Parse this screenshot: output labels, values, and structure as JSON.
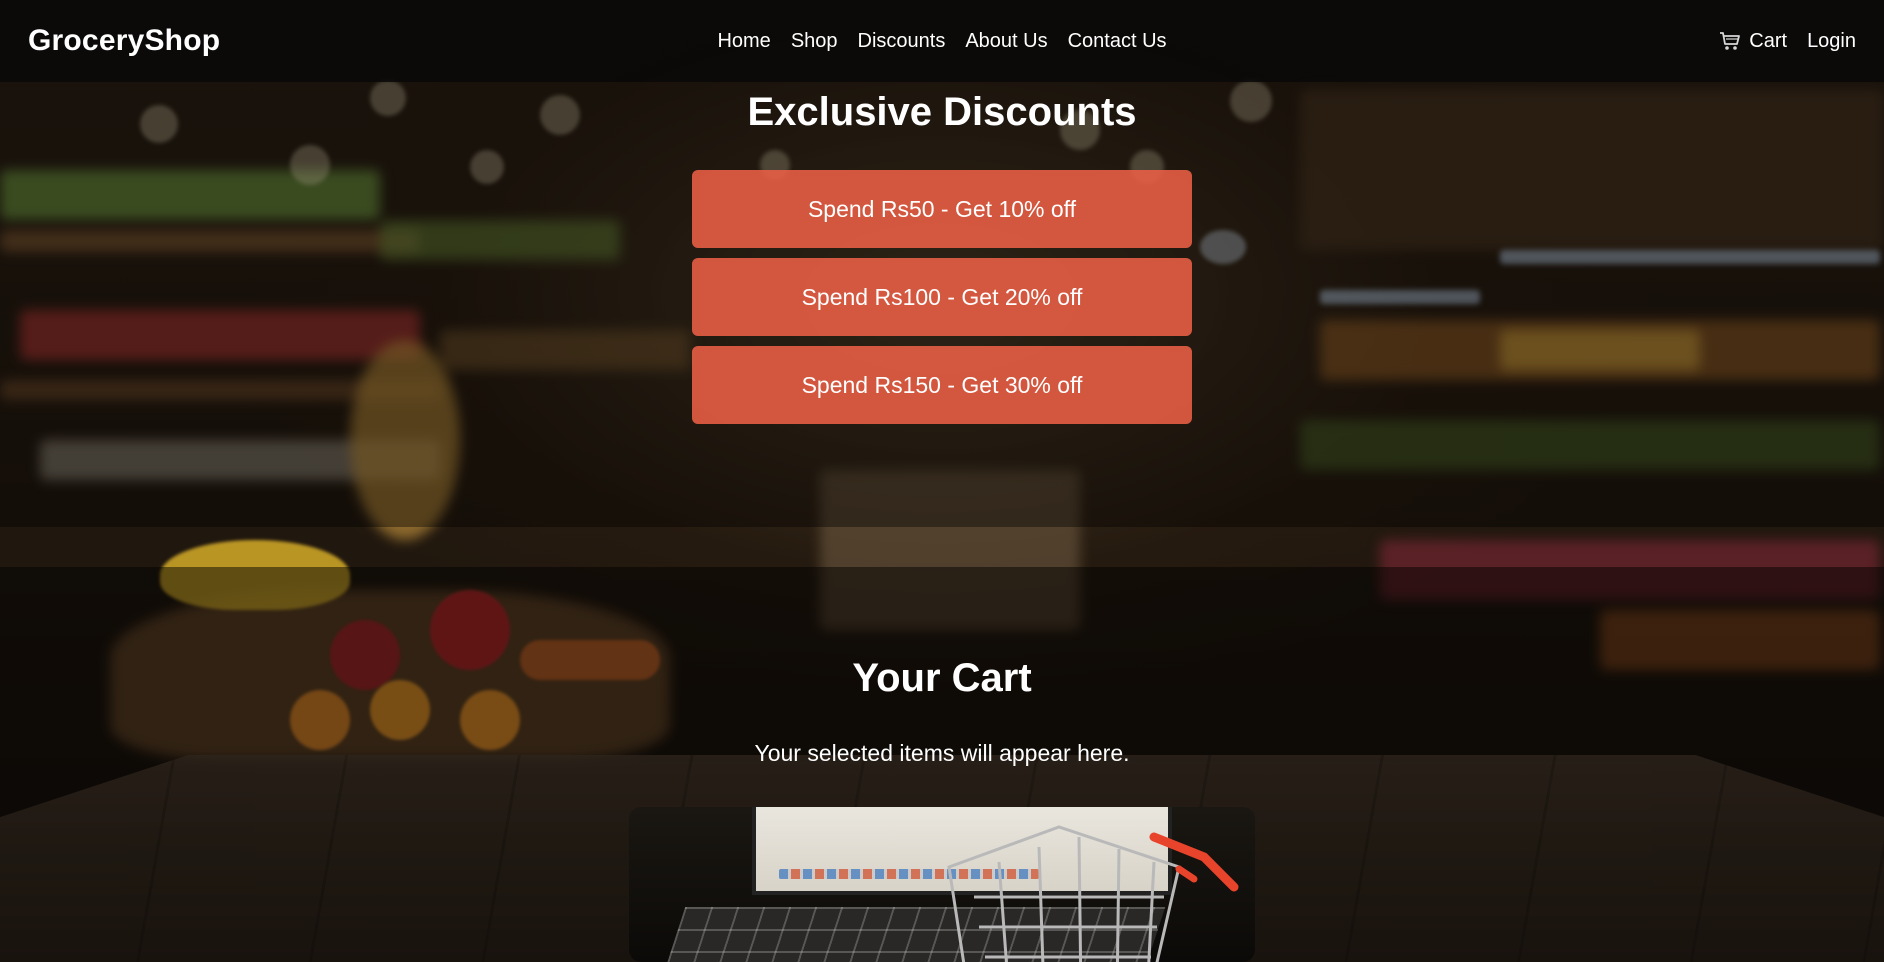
{
  "brand": "GroceryShop",
  "nav": {
    "links": [
      "Home",
      "Shop",
      "Discounts",
      "About Us",
      "Contact Us"
    ],
    "cart_label": "Cart",
    "cart_icon": "shopping-cart-icon",
    "login_label": "Login"
  },
  "discounts": {
    "title": "Exclusive Discounts",
    "offers": [
      "Spend Rs50 - Get 10% off",
      "Spend Rs100 - Get 20% off",
      "Spend Rs150 - Get 30% off"
    ]
  },
  "cart": {
    "title": "Your Cart",
    "subtitle": "Your selected items will appear here."
  },
  "colors": {
    "navbar": "#080808",
    "discount_button": "#ec6046",
    "cart_accent": "#e8442c"
  }
}
